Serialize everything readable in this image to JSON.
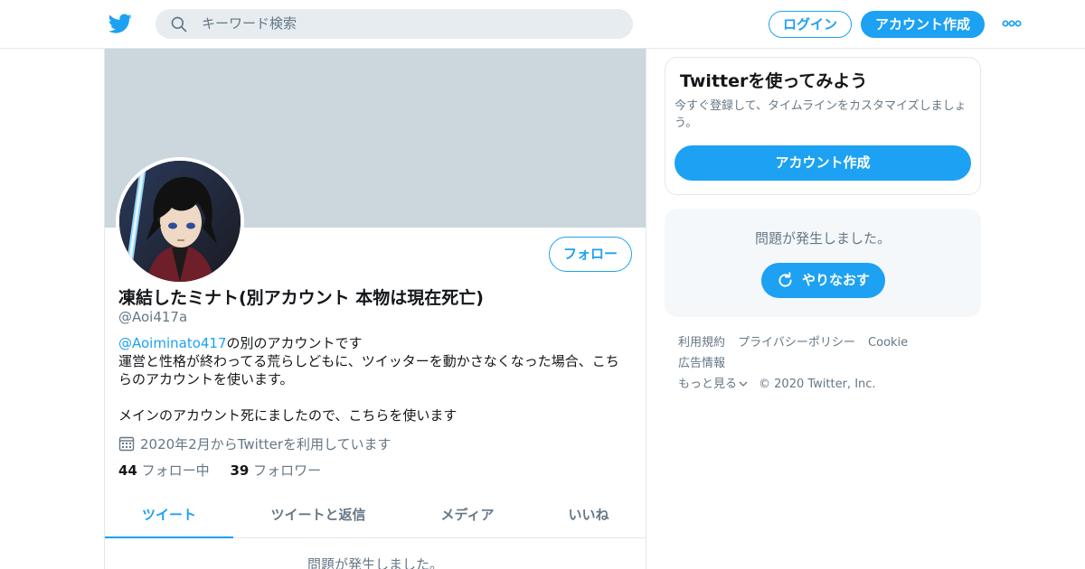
{
  "header": {
    "search_placeholder": "キーワード検索",
    "login_label": "ログイン",
    "signup_label": "アカウント作成",
    "logo_icon": "twitter-bird-icon",
    "more_icon": "more-dots-icon",
    "accent_color": "#1da1f2"
  },
  "profile": {
    "display_name": "凍結したミナト(別アカウント 本物は現在死亡)",
    "handle": "@Aoi417a",
    "follow_label": "フォロー",
    "bio_mention": "@Aoiminato417",
    "bio_mention_suffix": "の別のアカウントです",
    "bio_line2": "運営と性格が終わってる荒らしどもに、ツイッターを動かさなくなった場合、こち",
    "bio_line3": "らのアカウントを使います。",
    "bio_line4": "メインのアカウント死にましたので、こちらを使います",
    "joined": "2020年2月からTwitterを利用しています",
    "following_count": "44",
    "following_label": "フォロー中",
    "followers_count": "39",
    "followers_label": "フォロワー"
  },
  "tabs": [
    {
      "label": "ツイート",
      "active": true
    },
    {
      "label": "ツイートと返信",
      "active": false
    },
    {
      "label": "メディア",
      "active": false
    },
    {
      "label": "いいね",
      "active": false
    }
  ],
  "timeline": {
    "error_text": "問題が発生しました。"
  },
  "sidebar": {
    "signup_card": {
      "title": "Twitterを使ってみよう",
      "text": "今すぐ登録して、タイムラインをカスタマイズしましょう。",
      "button_label": "アカウント作成"
    },
    "error_card": {
      "text": "問題が発生しました。",
      "retry_label": "やりなおす"
    },
    "footer": {
      "links": [
        "利用規約",
        "プライバシーポリシー",
        "Cookie",
        "広告情報"
      ],
      "more_label": "もっと見る",
      "copyright": "© 2020 Twitter, Inc."
    }
  }
}
